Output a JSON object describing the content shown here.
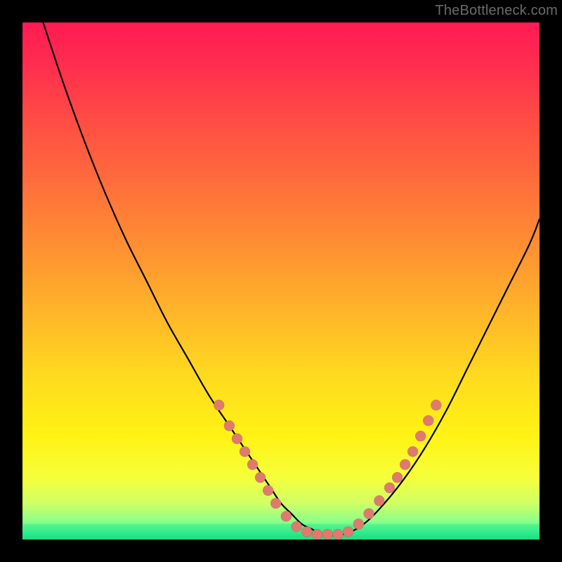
{
  "watermark": "TheBottleneck.com",
  "chart_data": {
    "type": "line",
    "title": "",
    "xlabel": "",
    "ylabel": "",
    "xlim": [
      0,
      100
    ],
    "ylim": [
      0,
      100
    ],
    "grid": false,
    "legend": false,
    "series": [
      {
        "name": "curve",
        "x": [
          4,
          8,
          12,
          16,
          20,
          24,
          28,
          32,
          36,
          40,
          42,
          44,
          46,
          48,
          50,
          52,
          54,
          56,
          58,
          62,
          66,
          70,
          74,
          78,
          82,
          86,
          90,
          94,
          98,
          100
        ],
        "y": [
          100,
          88,
          77,
          67,
          58,
          50,
          42,
          35,
          28,
          22,
          19,
          16,
          13,
          10,
          7,
          5,
          3,
          2,
          1,
          1,
          3,
          7,
          12,
          18,
          25,
          33,
          41,
          49,
          57,
          62
        ]
      }
    ],
    "plateau_band": {
      "y_center": 1.5,
      "half_height": 1.5
    },
    "markers": [
      {
        "x": 38,
        "y": 26
      },
      {
        "x": 40,
        "y": 22
      },
      {
        "x": 41.5,
        "y": 19.5
      },
      {
        "x": 43,
        "y": 17
      },
      {
        "x": 44.5,
        "y": 14.5
      },
      {
        "x": 46,
        "y": 12
      },
      {
        "x": 47.5,
        "y": 9.5
      },
      {
        "x": 49,
        "y": 7
      },
      {
        "x": 51,
        "y": 4.5
      },
      {
        "x": 53,
        "y": 2.5
      },
      {
        "x": 55,
        "y": 1.5
      },
      {
        "x": 57,
        "y": 1
      },
      {
        "x": 59,
        "y": 1
      },
      {
        "x": 61,
        "y": 1
      },
      {
        "x": 63,
        "y": 1.5
      },
      {
        "x": 65,
        "y": 3
      },
      {
        "x": 67,
        "y": 5
      },
      {
        "x": 69,
        "y": 7.5
      },
      {
        "x": 71,
        "y": 10
      },
      {
        "x": 72.5,
        "y": 12
      },
      {
        "x": 74,
        "y": 14.5
      },
      {
        "x": 75.5,
        "y": 17
      },
      {
        "x": 77,
        "y": 20
      },
      {
        "x": 78.5,
        "y": 23
      },
      {
        "x": 80,
        "y": 26
      }
    ],
    "gradient_stops": [
      {
        "offset": 0.0,
        "color": "#ff1a53"
      },
      {
        "offset": 0.08,
        "color": "#ff2d4f"
      },
      {
        "offset": 0.18,
        "color": "#ff4a45"
      },
      {
        "offset": 0.3,
        "color": "#ff6a3c"
      },
      {
        "offset": 0.42,
        "color": "#ff8c33"
      },
      {
        "offset": 0.55,
        "color": "#ffb22a"
      },
      {
        "offset": 0.68,
        "color": "#ffd91f"
      },
      {
        "offset": 0.8,
        "color": "#fff314"
      },
      {
        "offset": 0.88,
        "color": "#f6ff3a"
      },
      {
        "offset": 0.93,
        "color": "#cfff66"
      },
      {
        "offset": 0.965,
        "color": "#8bff8b"
      },
      {
        "offset": 0.985,
        "color": "#3af09a"
      },
      {
        "offset": 1.0,
        "color": "#12d97e"
      }
    ]
  }
}
